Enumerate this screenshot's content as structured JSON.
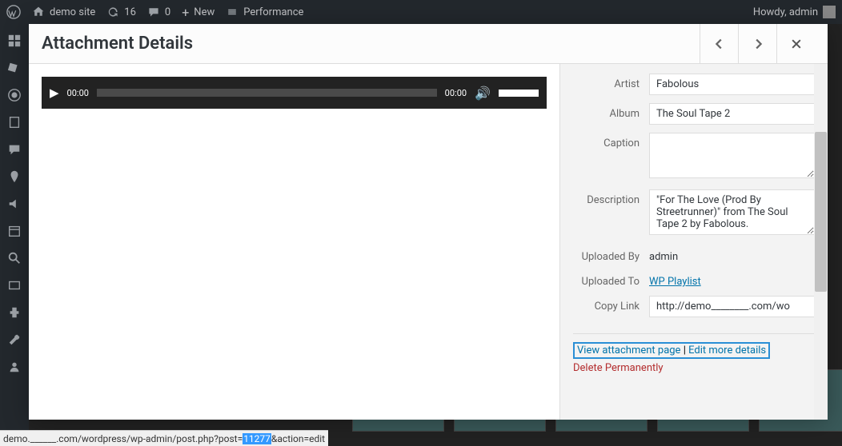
{
  "admin_bar": {
    "site_name": "demo site",
    "updates_count": "16",
    "comments_count": "0",
    "new_label": "New",
    "performance_label": "Performance",
    "howdy": "Howdy, admin"
  },
  "modal": {
    "title": "Attachment Details"
  },
  "audio": {
    "current": "00:00",
    "total": "00:00"
  },
  "fields": {
    "artist": {
      "label": "Artist",
      "value": "Fabolous"
    },
    "album": {
      "label": "Album",
      "value": "The Soul Tape 2"
    },
    "caption": {
      "label": "Caption",
      "value": ""
    },
    "description": {
      "label": "Description",
      "value": "\"For The Love (Prod By Streetrunner)\" from The Soul Tape 2 by Fabolous."
    },
    "uploaded_by": {
      "label": "Uploaded By",
      "value": "admin"
    },
    "uploaded_to": {
      "label": "Uploaded To",
      "link": "WP Playlist"
    },
    "copy_link": {
      "label": "Copy Link",
      "value": "http://demo________.com/wo"
    }
  },
  "actions": {
    "view": "View attachment page",
    "edit": "Edit more details",
    "delete": "Delete Permanently"
  },
  "status_bar": {
    "prefix": "demo.______.com/wordpress/wp-admin/post.php?post=",
    "id": "11277",
    "suffix": "&action=edit"
  }
}
